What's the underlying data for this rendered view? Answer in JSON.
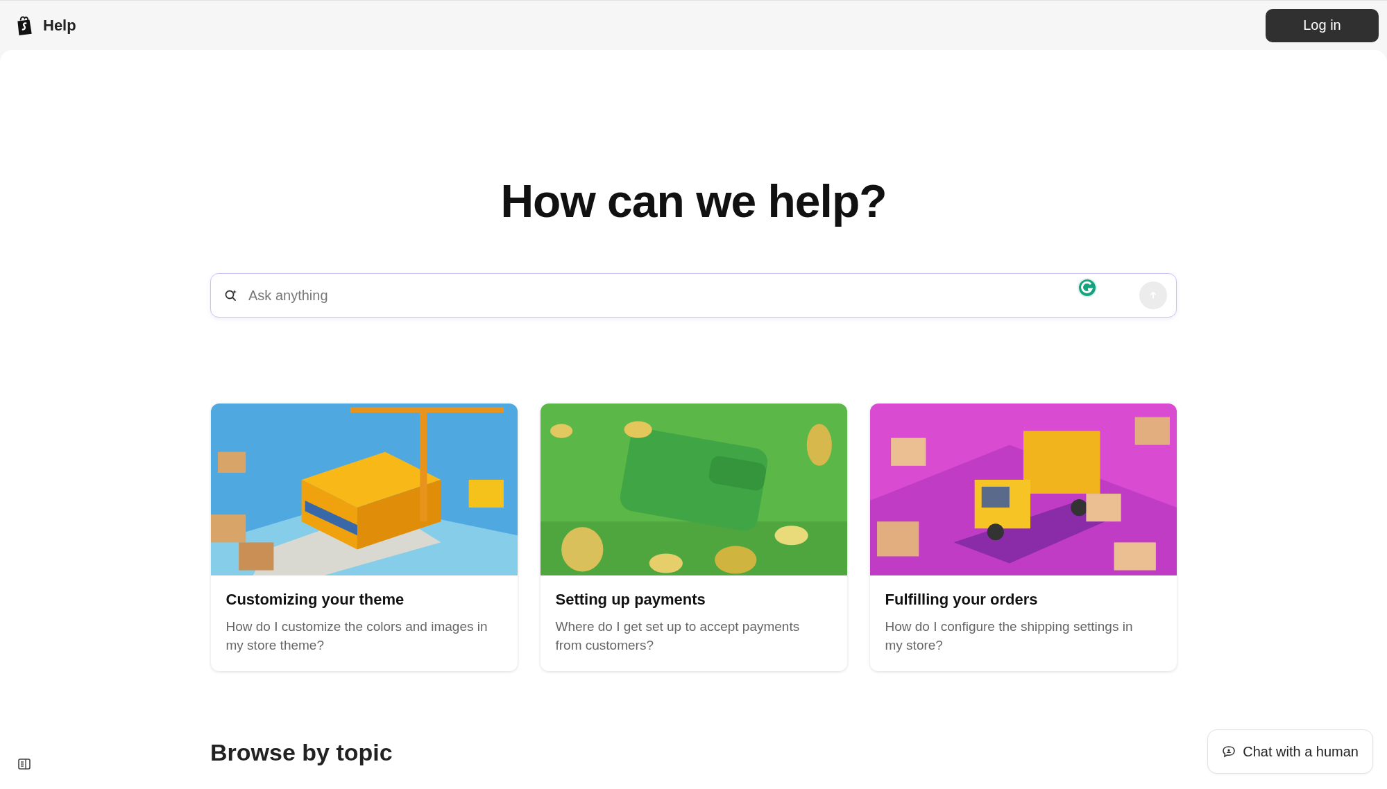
{
  "header": {
    "title": "Help",
    "login_button": "Log in"
  },
  "hero": {
    "heading": "How can we help?",
    "search": {
      "placeholder": "Ask anything"
    }
  },
  "cards": [
    {
      "title": "Customizing your theme",
      "description": "How do I customize the colors and images in my store theme?",
      "kind": "picture"
    },
    {
      "title": "Setting up payments",
      "description": "Where do I get set up to accept payments from customers?",
      "kind": "picture"
    },
    {
      "title": "Fulfilling your orders",
      "description": "How do I configure the shipping settings in my store?",
      "kind": "picture"
    }
  ],
  "section_heading": "Browse by topic",
  "chat_button": "Chat with a human"
}
